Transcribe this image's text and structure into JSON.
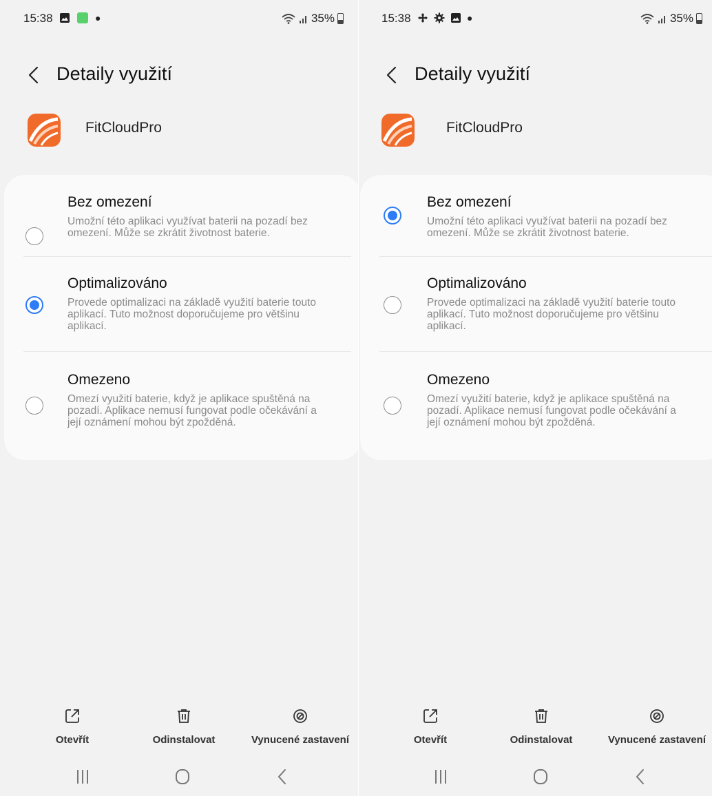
{
  "screens": [
    {
      "status_time": "15:38",
      "status_left_icons": [
        "gallery-icon",
        "fitness-icon",
        "dot"
      ],
      "battery": "35%",
      "title": "Detaily využití",
      "app_name": "FitCloudPro",
      "options": [
        {
          "title": "Bez omezení",
          "desc": "Umožní této aplikaci využívat baterii na pozadí bez omezení. Může se zkrátit životnost baterie.",
          "checked": false
        },
        {
          "title": "Optimalizováno",
          "desc": "Provede optimalizaci na základě využití baterie touto aplikací. Tuto možnost doporučujeme pro většinu aplikací.",
          "checked": true
        },
        {
          "title": "Omezeno",
          "desc": "Omezí využití baterie, když je aplikace spuštěná na pozadí. Aplikace nemusí fungovat podle očekávání a její oznámení mohou být zpožděná.",
          "checked": false
        }
      ],
      "actions": [
        {
          "label": "Otevřít",
          "icon": "open-external-icon"
        },
        {
          "label": "Odinstalovat",
          "icon": "trash-icon"
        },
        {
          "label": "Vynucené zastavení",
          "icon": "force-stop-icon"
        }
      ]
    },
    {
      "status_time": "15:38",
      "status_left_icons": [
        "fan-icon",
        "settings-icon",
        "gallery-icon",
        "dot"
      ],
      "battery": "35%",
      "title": "Detaily využití",
      "app_name": "FitCloudPro",
      "options": [
        {
          "title": "Bez omezení",
          "desc": "Umožní této aplikaci využívat baterii na pozadí bez omezení. Může se zkrátit životnost baterie.",
          "checked": true
        },
        {
          "title": "Optimalizováno",
          "desc": "Provede optimalizaci na základě využití baterie touto aplikací. Tuto možnost doporučujeme pro většinu aplikací.",
          "checked": false
        },
        {
          "title": "Omezeno",
          "desc": "Omezí využití baterie, když je aplikace spuštěná na pozadí. Aplikace nemusí fungovat podle očekávání a její oznámení mohou být zpožděná.",
          "checked": false
        }
      ],
      "actions": [
        {
          "label": "Otevřít",
          "icon": "open-external-icon"
        },
        {
          "label": "Odinstalovat",
          "icon": "trash-icon"
        },
        {
          "label": "Vynucené zastavení",
          "icon": "force-stop-icon"
        }
      ]
    }
  ],
  "colors": {
    "accent": "#2e7cf6",
    "background": "#f2f2f2",
    "card": "#fafafa",
    "app_icon": "#f06a2a"
  }
}
